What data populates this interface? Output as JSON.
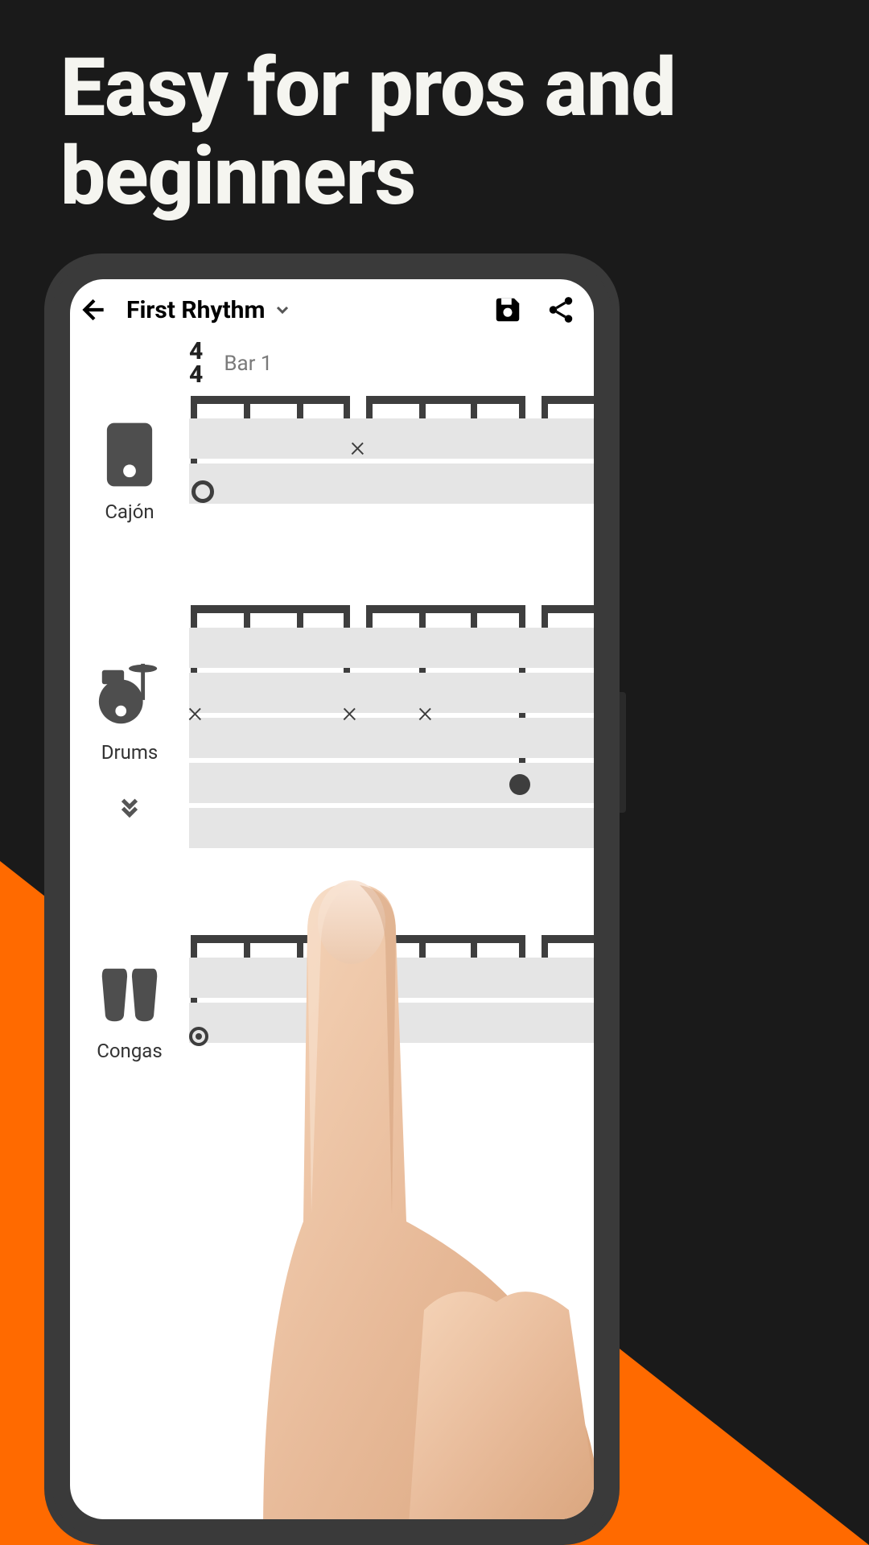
{
  "marketing": {
    "headline": "Easy for pros and beginners"
  },
  "topbar": {
    "title": "First Rhythm"
  },
  "meta": {
    "time_sig_top": "4",
    "time_sig_bottom": "4",
    "bar_label": "Bar 1"
  },
  "instruments": {
    "cajon": {
      "label": "Cajón"
    },
    "drums": {
      "label": "Drums"
    },
    "congas": {
      "label": "Congas"
    }
  }
}
